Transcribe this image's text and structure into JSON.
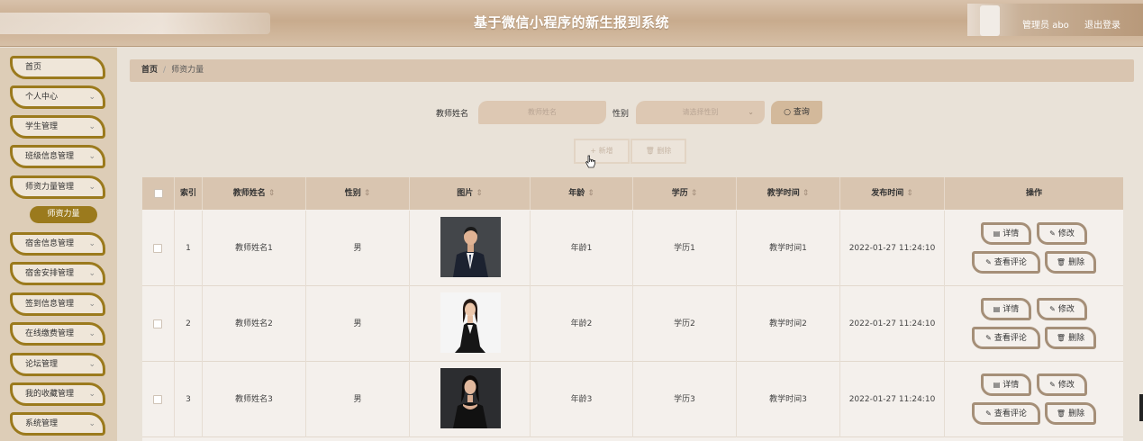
{
  "header": {
    "title": "基于微信小程序的新生报到系统",
    "user_label": "管理员 abo",
    "logout_label": "退出登录"
  },
  "sidebar": {
    "items": [
      {
        "label": "首页",
        "has_chevron": false
      },
      {
        "label": "个人中心",
        "has_chevron": true
      },
      {
        "label": "学生管理",
        "has_chevron": true
      },
      {
        "label": "班级信息管理",
        "has_chevron": true
      },
      {
        "label": "师资力量管理",
        "has_chevron": true
      },
      {
        "label": "宿舍信息管理",
        "has_chevron": true
      },
      {
        "label": "宿舍安排管理",
        "has_chevron": true
      },
      {
        "label": "签到信息管理",
        "has_chevron": true
      },
      {
        "label": "在线缴费管理",
        "has_chevron": true
      },
      {
        "label": "论坛管理",
        "has_chevron": true
      },
      {
        "label": "我的收藏管理",
        "has_chevron": true
      },
      {
        "label": "系统管理",
        "has_chevron": true
      }
    ],
    "active_sub": "师资力量"
  },
  "breadcrumb": {
    "home": "首页",
    "current": "师资力量"
  },
  "search": {
    "name_label": "教师姓名",
    "name_placeholder": "教师姓名",
    "gender_label": "性别",
    "gender_placeholder": "请选择性别",
    "query_label": "查询"
  },
  "actions": {
    "add_label": "新增",
    "delete_label": "删除"
  },
  "table": {
    "headers": [
      "索引",
      "教师姓名",
      "性别",
      "图片",
      "年龄",
      "学历",
      "教学时间",
      "发布时间",
      "操作"
    ],
    "rows": [
      {
        "index": "1",
        "name": "教师姓名1",
        "gender": "男",
        "age": "年龄1",
        "edu": "学历1",
        "teach_time": "教学时间1",
        "publish_time": "2022-01-27 11:24:10"
      },
      {
        "index": "2",
        "name": "教师姓名2",
        "gender": "男",
        "age": "年龄2",
        "edu": "学历2",
        "teach_time": "教学时间2",
        "publish_time": "2022-01-27 11:24:10"
      },
      {
        "index": "3",
        "name": "教师姓名3",
        "gender": "男",
        "age": "年龄3",
        "edu": "学历3",
        "teach_time": "教学时间3",
        "publish_time": "2022-01-27 11:24:10"
      }
    ],
    "ops": {
      "detail": "详情",
      "edit": "修改",
      "comment": "查看评论",
      "delete": "删除"
    }
  },
  "colors": {
    "accent_gold": "#9b7a1d",
    "header_tan": "#c8ab8d",
    "table_head": "#d9c5b0"
  }
}
